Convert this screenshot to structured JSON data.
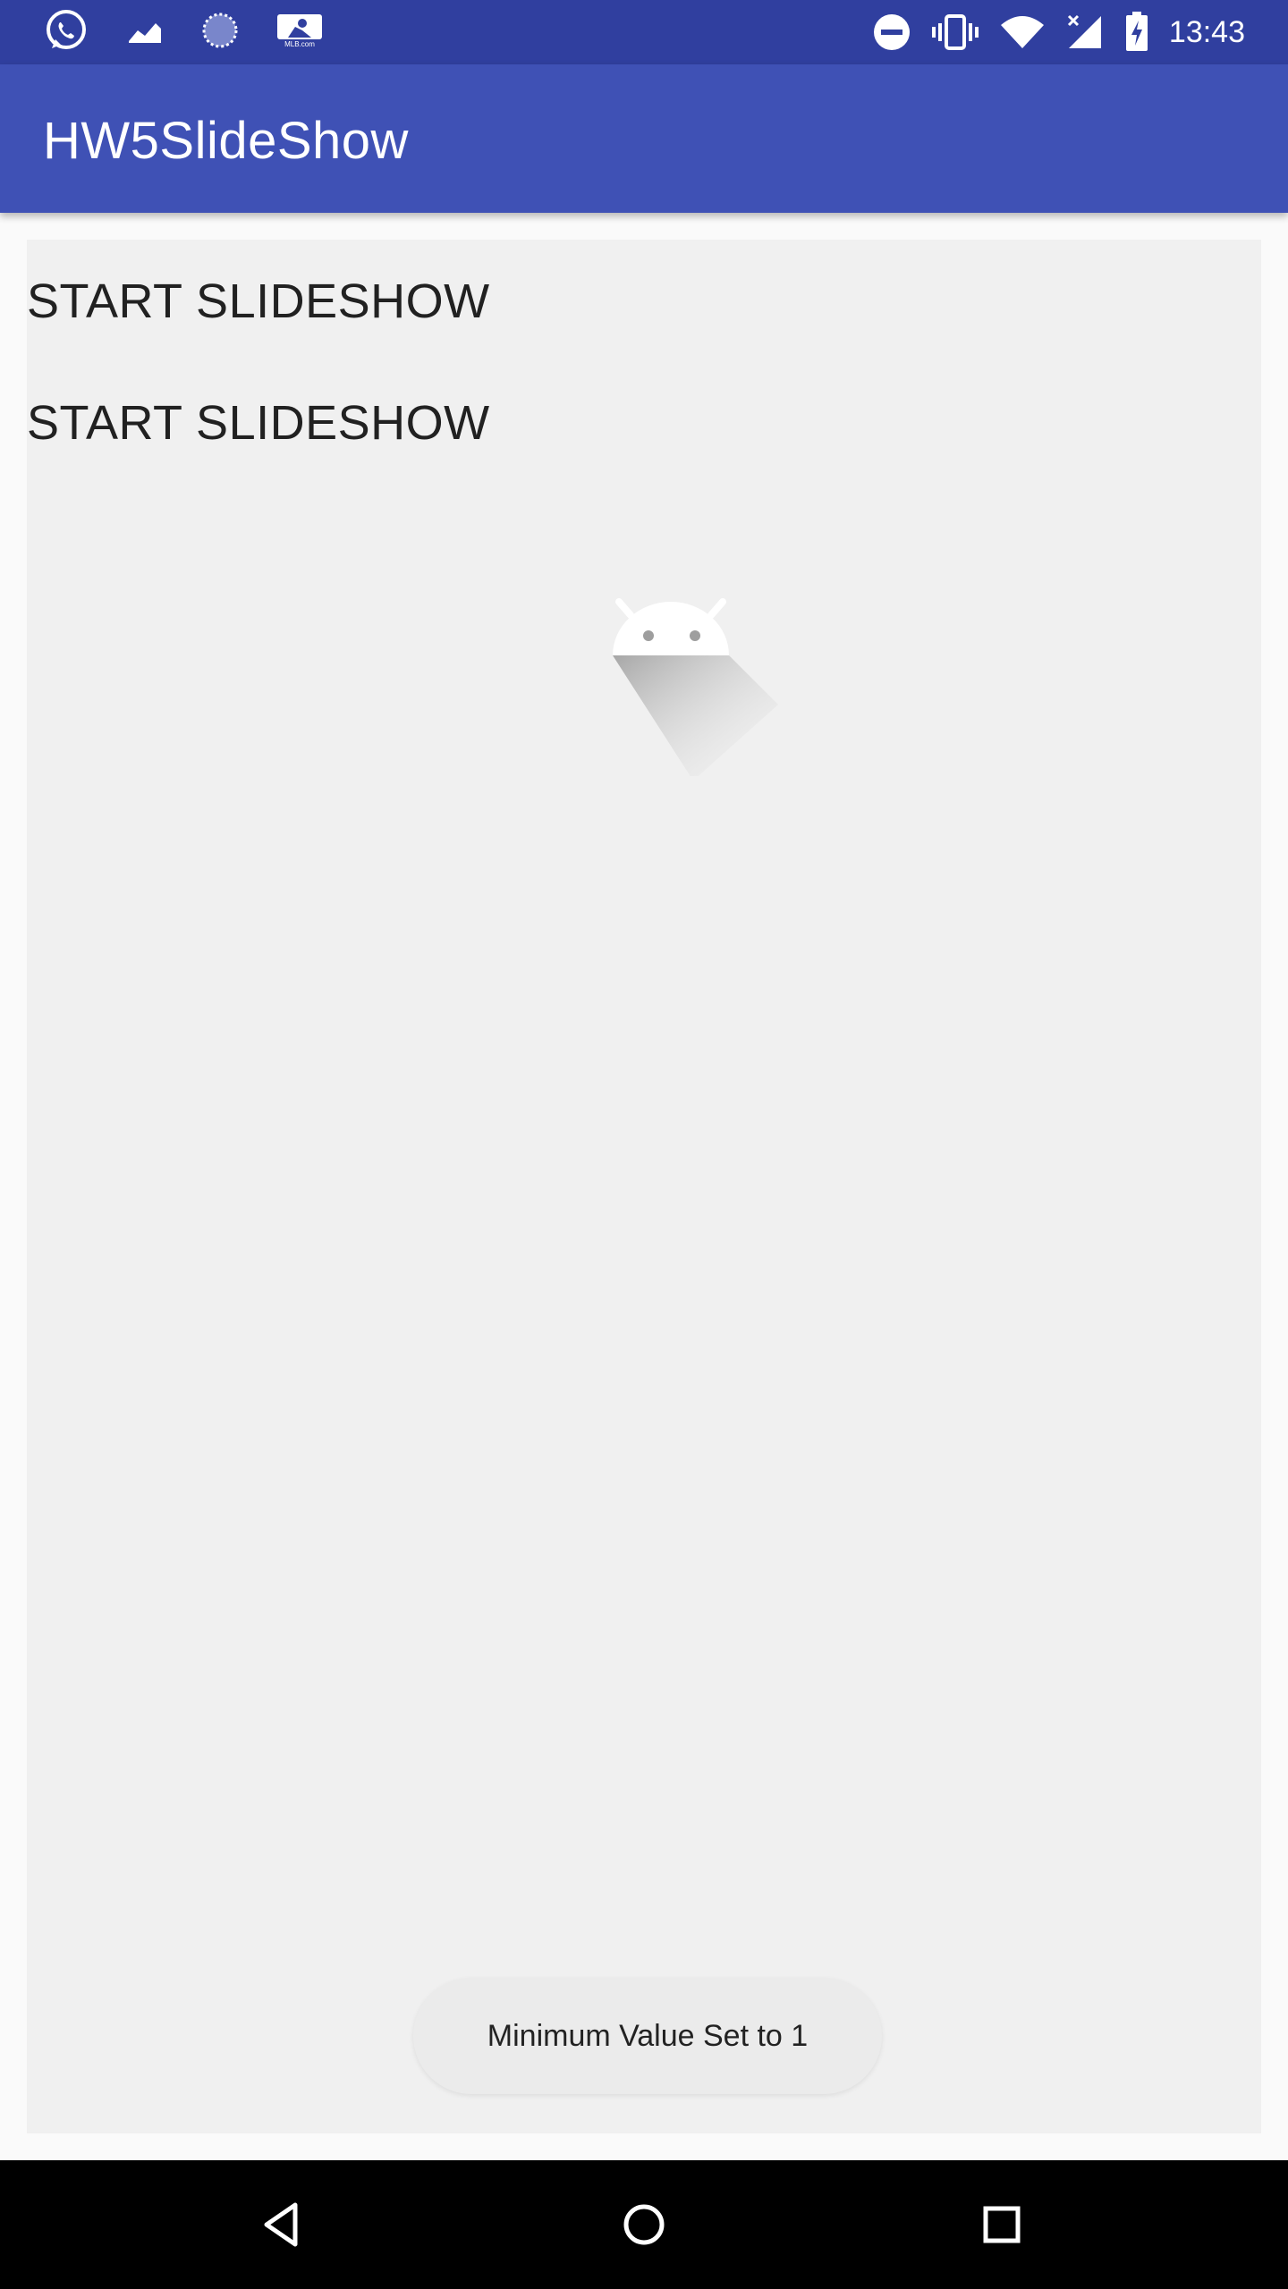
{
  "status_bar": {
    "time": "13:43",
    "left_icons": [
      "whatsapp-icon",
      "chart-icon",
      "circle-loading-icon",
      "mlb-icon"
    ],
    "right_icons": [
      "do-not-disturb-icon",
      "vibrate-icon",
      "wifi-icon",
      "signal-no-data-icon",
      "battery-charging-icon"
    ],
    "mlb_text": "MLB.com"
  },
  "app_bar": {
    "title": "HW5SlideShow"
  },
  "main": {
    "actions": [
      {
        "label": "START SLIDESHOW"
      },
      {
        "label": "START SLIDESHOW"
      }
    ],
    "image_icon": "android-placeholder-icon"
  },
  "toast": {
    "message": "Minimum Value Set to 1"
  },
  "nav_bar": {
    "buttons": [
      "back-icon",
      "home-icon",
      "recents-icon"
    ]
  },
  "colors": {
    "status_bar": "#303f9f",
    "app_bar": "#3f51b5",
    "content_bg": "#f0f0f0",
    "page_bg": "#fafafa",
    "nav_bar": "#000000"
  }
}
